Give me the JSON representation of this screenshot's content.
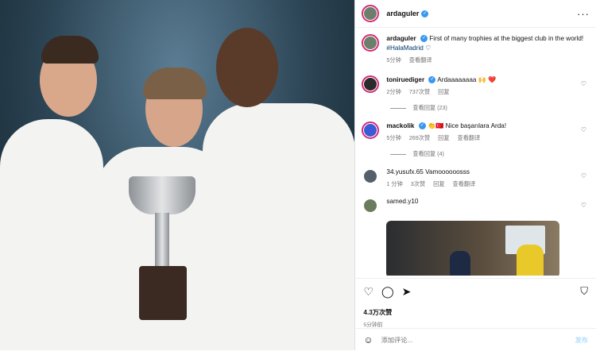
{
  "header": {
    "username": "ardaguler",
    "verified_icon": "verified-badge-icon",
    "more_icon": "more-dots-icon"
  },
  "caption": {
    "username": "ardaguler",
    "text": "First of many trophies at the biggest club in the world!",
    "hashtag": "#HalaMadrid",
    "emoji": "♡",
    "time": "5分钟",
    "translate": "查看翻译"
  },
  "comments": [
    {
      "username": "toniruediger",
      "text": "Ardaaaaaaaa 🙌 ❤️",
      "time": "2分钟",
      "likes": "737次赞",
      "reply": "回复",
      "view_replies": "查看回复 (23)"
    },
    {
      "username": "mackolik",
      "text": "👏🇹🇷 Nice başarılara Arda!",
      "time": "5分钟",
      "likes": "269次赞",
      "reply": "回复",
      "translate": "查看翻译",
      "view_replies": "查看回复 (4)"
    },
    {
      "username": "34.yusufx.65",
      "text": "Vamoooooosss",
      "time": "1 分钟",
      "likes": "3次赞",
      "reply": "回复",
      "translate": "查看翻译"
    },
    {
      "username": "samed.y10",
      "text": ""
    }
  ],
  "actions": {
    "likes": "4.3万次赞",
    "posted": "5分钟前"
  },
  "comment_box": {
    "placeholder": "添加评论...",
    "post": "发布"
  },
  "colors": {
    "accent": "#3897f0",
    "ring": "#d62976",
    "heart": "#ed4956"
  }
}
